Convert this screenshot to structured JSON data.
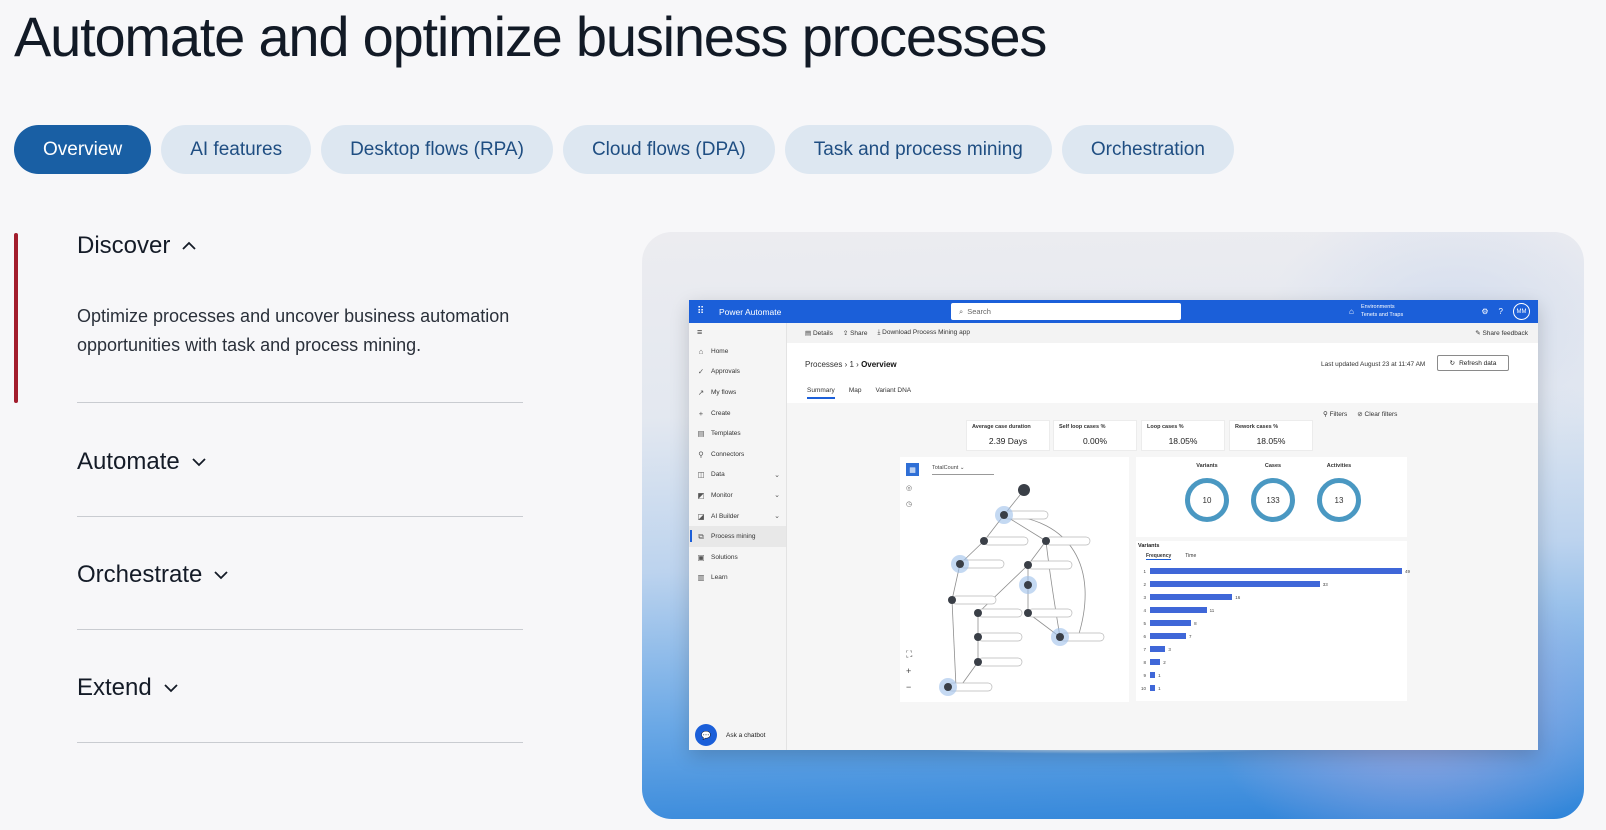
{
  "headline": "Automate and optimize business processes",
  "tabs": [
    {
      "label": "Overview",
      "active": true
    },
    {
      "label": "AI features"
    },
    {
      "label": "Desktop flows (RPA)"
    },
    {
      "label": "Cloud flows (DPA)"
    },
    {
      "label": "Task and process mining"
    },
    {
      "label": "Orchestration"
    }
  ],
  "accordion": [
    {
      "title": "Discover",
      "expanded": true,
      "body": "Optimize processes and uncover business automation opportunities with task and process mining."
    },
    {
      "title": "Automate",
      "expanded": false
    },
    {
      "title": "Orchestrate",
      "expanded": false
    },
    {
      "title": "Extend",
      "expanded": false
    }
  ],
  "colors": {
    "accent": "#195fa4",
    "indicator": "#a21d2d",
    "app_bar": "#1b5fd9",
    "ring": "#4a98c2",
    "bar": "#3f67d8"
  },
  "app": {
    "name": "Power Automate",
    "search_placeholder": "Search",
    "env_label": "Environments",
    "env_name": "Tenets and Traps",
    "avatar": "MM",
    "nav": [
      {
        "label": "Home",
        "icon": "home-icon"
      },
      {
        "label": "Approvals",
        "icon": "approvals-icon"
      },
      {
        "label": "My flows",
        "icon": "flows-icon"
      },
      {
        "label": "Create",
        "icon": "plus-icon"
      },
      {
        "label": "Templates",
        "icon": "templates-icon"
      },
      {
        "label": "Connectors",
        "icon": "connectors-icon"
      },
      {
        "label": "Data",
        "icon": "data-icon",
        "caret": true
      },
      {
        "label": "Monitor",
        "icon": "monitor-icon",
        "caret": true
      },
      {
        "label": "AI Builder",
        "icon": "ai-icon",
        "caret": true
      },
      {
        "label": "Process mining",
        "icon": "process-mining-icon",
        "active": true
      },
      {
        "label": "Solutions",
        "icon": "solutions-icon"
      },
      {
        "label": "Learn",
        "icon": "learn-icon"
      }
    ],
    "chatbot": "Ask a chatbot",
    "cmd": {
      "details": "Details",
      "share": "Share",
      "download": "Download Process Mining app",
      "feedback": "Share feedback"
    },
    "crumbs": {
      "root": "Processes",
      "mid": "1",
      "current": "Overview"
    },
    "last_updated": "Last updated August 23 at 11:47 AM",
    "refresh": "Refresh data",
    "page_tabs": [
      "Summary",
      "Map",
      "Variant DNA"
    ],
    "filters": "Filters",
    "clear_filters": "Clear filters",
    "kpis": [
      {
        "label": "Average case duration",
        "value": "2.39 Days"
      },
      {
        "label": "Self loop cases %",
        "value": "0.00%"
      },
      {
        "label": "Loop cases %",
        "value": "18.05%"
      },
      {
        "label": "Rework cases %",
        "value": "18.05%"
      }
    ],
    "map_metric": "TotalCount",
    "stats": [
      {
        "label": "Variants",
        "value": "10"
      },
      {
        "label": "Cases",
        "value": "133"
      },
      {
        "label": "Activities",
        "value": "13"
      }
    ],
    "variants_title": "Variants",
    "variant_tabs": [
      "Frequency",
      "Time"
    ],
    "variants": [
      {
        "rank": "1",
        "count": 49
      },
      {
        "rank": "2",
        "count": 33
      },
      {
        "rank": "3",
        "count": 16
      },
      {
        "rank": "4",
        "count": 11
      },
      {
        "rank": "5",
        "count": 8
      },
      {
        "rank": "6",
        "count": 7
      },
      {
        "rank": "7",
        "count": 3
      },
      {
        "rank": "8",
        "count": 2
      },
      {
        "rank": "9",
        "count": 1
      },
      {
        "rank": "10",
        "count": 1
      }
    ]
  }
}
